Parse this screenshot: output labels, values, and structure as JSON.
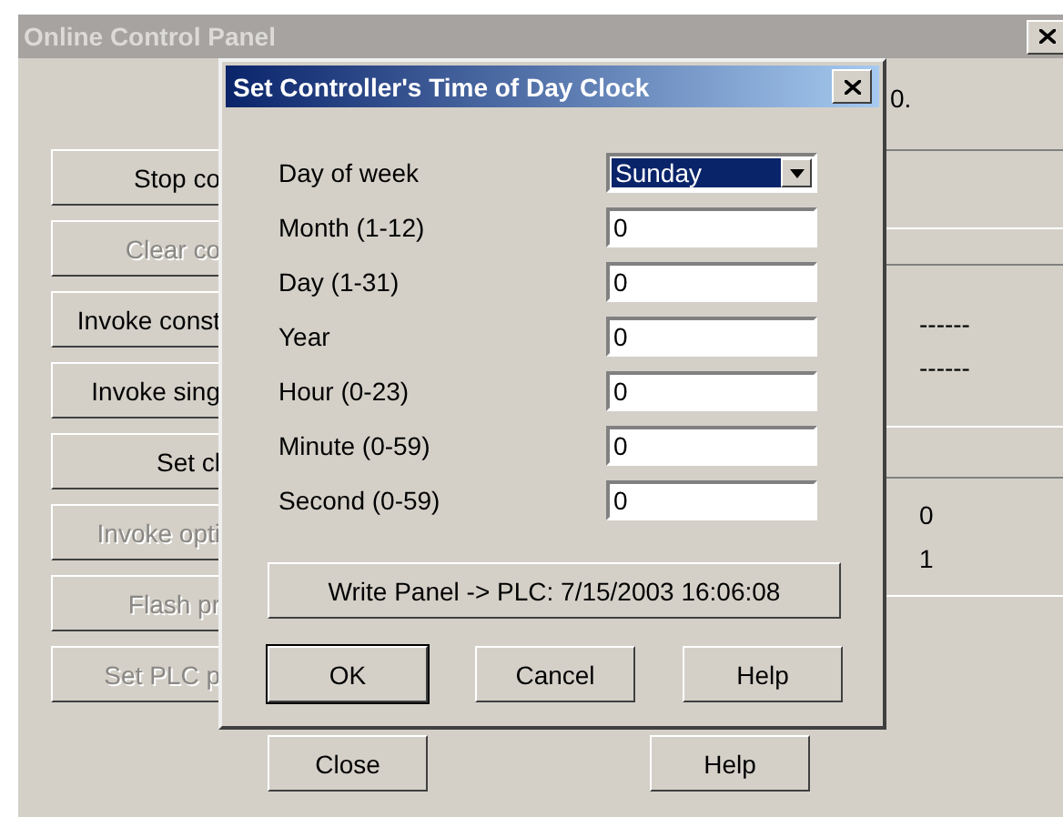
{
  "main_window": {
    "title": "Online Control Panel",
    "partial_text": "0.",
    "buttons": [
      {
        "label": "Stop co",
        "disabled": false
      },
      {
        "label": "Clear co",
        "disabled": true
      },
      {
        "label": "Invoke const",
        "disabled": false
      },
      {
        "label": "Invoke sing",
        "disabled": false
      },
      {
        "label": "Set cl",
        "disabled": false
      },
      {
        "label": "Invoke opti",
        "disabled": true
      },
      {
        "label": "Flash pr",
        "disabled": true
      },
      {
        "label": "Set PLC p",
        "disabled": true
      }
    ],
    "group_2": [
      "------",
      "------"
    ],
    "group_3": [
      "0",
      "1"
    ],
    "footer_buttons": [
      "Close",
      "Help"
    ]
  },
  "dialog": {
    "title": "Set Controller's Time of Day Clock",
    "fields": [
      {
        "label": "Day of week",
        "kind": "dropdown",
        "value": "Sunday"
      },
      {
        "label": "Month (1-12)",
        "kind": "text",
        "value": "0"
      },
      {
        "label": "Day (1-31)",
        "kind": "text",
        "value": "0"
      },
      {
        "label": "Year",
        "kind": "text",
        "value": "0"
      },
      {
        "label": "Hour (0-23)",
        "kind": "text",
        "value": "0"
      },
      {
        "label": "Minute (0-59)",
        "kind": "text",
        "value": "0"
      },
      {
        "label": "Second (0-59)",
        "kind": "text",
        "value": "0"
      }
    ],
    "write_button": "Write Panel -> PLC:  7/15/2003 16:06:08",
    "buttons": [
      {
        "label": "OK",
        "default": true
      },
      {
        "label": "Cancel",
        "default": false
      },
      {
        "label": "Help",
        "default": false
      }
    ]
  }
}
